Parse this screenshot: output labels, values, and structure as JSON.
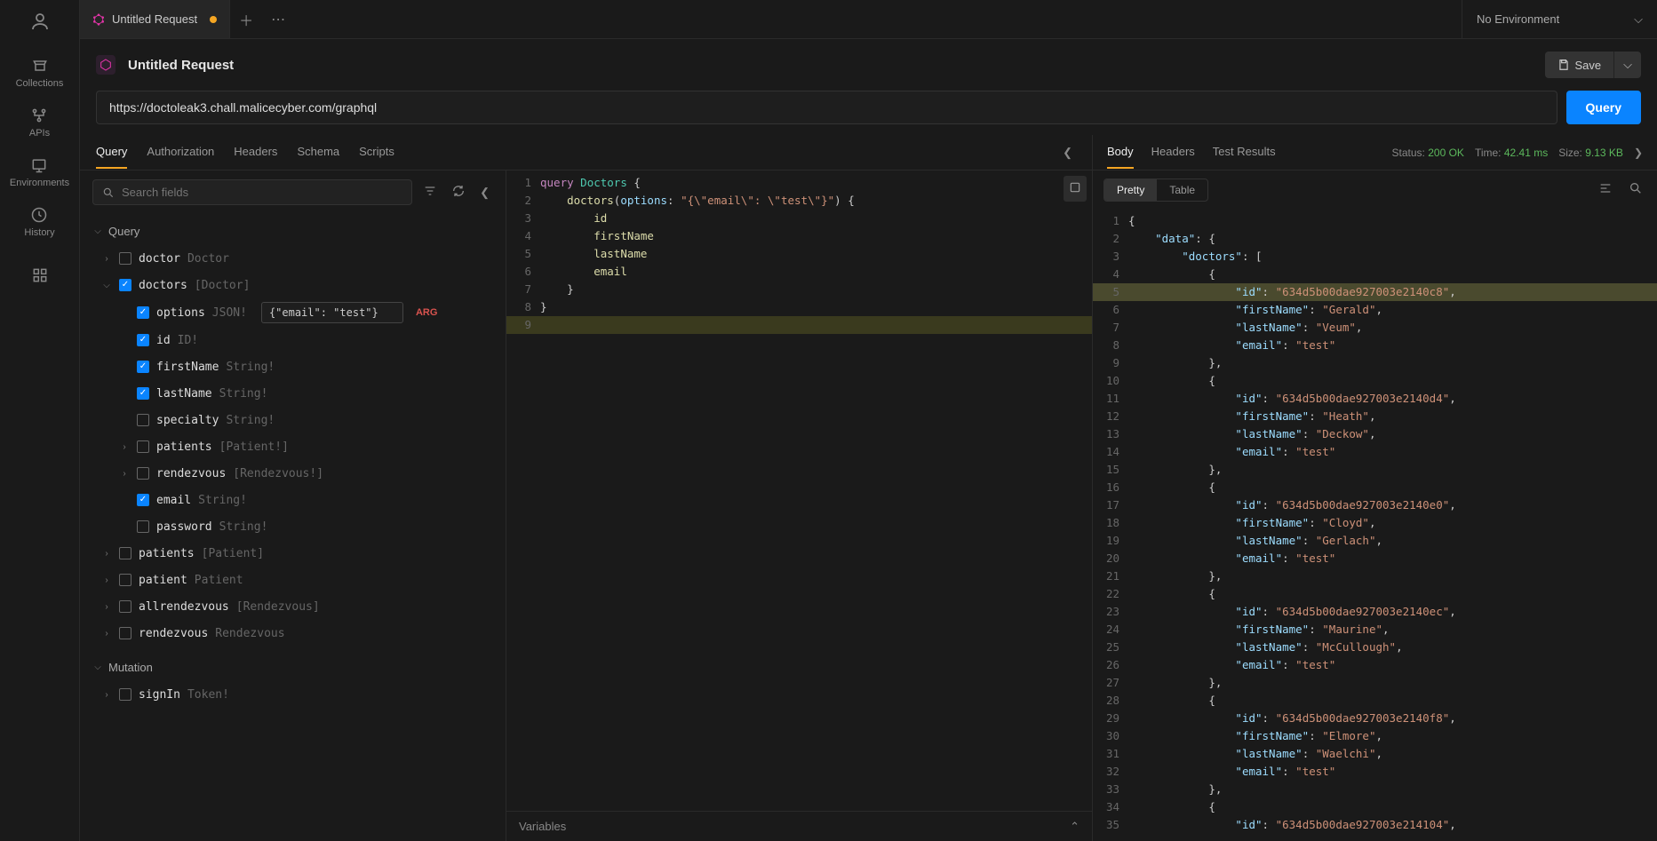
{
  "rail": {
    "items": [
      {
        "label": "Collections"
      },
      {
        "label": "APIs"
      },
      {
        "label": "Environments"
      },
      {
        "label": "History"
      }
    ]
  },
  "tab": {
    "title": "Untitled Request"
  },
  "env": {
    "label": "No Environment"
  },
  "request": {
    "title": "Untitled Request",
    "url": "https://doctoleak3.chall.malicecyber.com/graphql",
    "save_label": "Save",
    "query_label": "Query"
  },
  "req_tabs": [
    "Query",
    "Authorization",
    "Headers",
    "Schema",
    "Scripts"
  ],
  "req_active_tab": "Query",
  "schema_search_placeholder": "Search fields",
  "schema": {
    "query_label": "Query",
    "mutation_label": "Mutation",
    "fields": [
      {
        "name": "doctor",
        "type": "Doctor",
        "checked": false,
        "expandable": true,
        "depth": 1
      },
      {
        "name": "doctors",
        "type": "[Doctor]",
        "checked": true,
        "expandable": true,
        "expanded": true,
        "depth": 1
      },
      {
        "name": "options",
        "type": "JSON!",
        "checked": true,
        "depth": 2,
        "arg": true,
        "value": "{\"email\": \"test\"}"
      },
      {
        "name": "id",
        "type": "ID!",
        "checked": true,
        "depth": 2
      },
      {
        "name": "firstName",
        "type": "String!",
        "checked": true,
        "depth": 2
      },
      {
        "name": "lastName",
        "type": "String!",
        "checked": true,
        "depth": 2
      },
      {
        "name": "specialty",
        "type": "String!",
        "checked": false,
        "depth": 2
      },
      {
        "name": "patients",
        "type": "[Patient!]",
        "checked": false,
        "expandable": true,
        "depth": 2
      },
      {
        "name": "rendezvous",
        "type": "[Rendezvous!]",
        "checked": false,
        "expandable": true,
        "depth": 2
      },
      {
        "name": "email",
        "type": "String!",
        "checked": true,
        "depth": 2
      },
      {
        "name": "password",
        "type": "String!",
        "checked": false,
        "depth": 2
      },
      {
        "name": "patients",
        "type": "[Patient]",
        "checked": false,
        "expandable": true,
        "depth": 1
      },
      {
        "name": "patient",
        "type": "Patient",
        "checked": false,
        "expandable": true,
        "depth": 1
      },
      {
        "name": "allrendezvous",
        "type": "[Rendezvous]",
        "checked": false,
        "expandable": true,
        "depth": 1
      },
      {
        "name": "rendezvous",
        "type": "Rendezvous",
        "checked": false,
        "expandable": true,
        "depth": 1
      }
    ],
    "mutations": [
      {
        "name": "signIn",
        "type": "Token!",
        "checked": false,
        "expandable": true,
        "depth": 1
      }
    ]
  },
  "editor": {
    "lines": [
      {
        "n": 1,
        "html": "<span class='kw-purple'>query</span> <span class='kw-teal'>Doctors</span> <span class='brace'>{</span>"
      },
      {
        "n": 2,
        "html": "    <span class='kw-yellow'>doctors</span>(<span class='kw-blue'>options</span>: <span class='kw-str'>\"{\\\"email\\\": \\\"test\\\"}\"</span>) <span class='brace'>{</span>"
      },
      {
        "n": 3,
        "html": "        <span class='kw-yellow'>id</span>"
      },
      {
        "n": 4,
        "html": "        <span class='kw-yellow'>firstName</span>"
      },
      {
        "n": 5,
        "html": "        <span class='kw-yellow'>lastName</span>"
      },
      {
        "n": 6,
        "html": "        <span class='kw-yellow'>email</span>"
      },
      {
        "n": 7,
        "html": "    <span class='brace'>}</span>"
      },
      {
        "n": 8,
        "html": "<span class='brace'>}</span>"
      },
      {
        "n": 9,
        "html": ""
      }
    ],
    "variables_label": "Variables"
  },
  "response": {
    "tabs": [
      "Body",
      "Headers",
      "Test Results"
    ],
    "active_tab": "Body",
    "status_label": "Status:",
    "status_value": "200 OK",
    "time_label": "Time:",
    "time_value": "42.41 ms",
    "size_label": "Size:",
    "size_value": "9.13 KB",
    "view_modes": [
      "Pretty",
      "Table"
    ],
    "active_mode": "Pretty",
    "lines": [
      {
        "n": 1,
        "t": "<span class='brace'>{</span>"
      },
      {
        "n": 2,
        "t": "    <span class='kw-key'>\"data\"</span>: <span class='brace'>{</span>"
      },
      {
        "n": 3,
        "t": "        <span class='kw-key'>\"doctors\"</span>: <span class='brace'>[</span>"
      },
      {
        "n": 4,
        "t": "            <span class='brace'>{</span>"
      },
      {
        "n": 5,
        "hl": true,
        "t": "                <span class='kw-key'>\"id\"</span>: <span class='kw-str'>\"634d5b00dae927003e2140c8\"</span>,"
      },
      {
        "n": 6,
        "t": "                <span class='kw-key'>\"firstName\"</span>: <span class='kw-str'>\"Gerald\"</span>,"
      },
      {
        "n": 7,
        "t": "                <span class='kw-key'>\"lastName\"</span>: <span class='kw-str'>\"Veum\"</span>,"
      },
      {
        "n": 8,
        "t": "                <span class='kw-key'>\"email\"</span>: <span class='kw-str'>\"test\"</span>"
      },
      {
        "n": 9,
        "t": "            <span class='brace'>}</span>,"
      },
      {
        "n": 10,
        "t": "            <span class='brace'>{</span>"
      },
      {
        "n": 11,
        "t": "                <span class='kw-key'>\"id\"</span>: <span class='kw-str'>\"634d5b00dae927003e2140d4\"</span>,"
      },
      {
        "n": 12,
        "t": "                <span class='kw-key'>\"firstName\"</span>: <span class='kw-str'>\"Heath\"</span>,"
      },
      {
        "n": 13,
        "t": "                <span class='kw-key'>\"lastName\"</span>: <span class='kw-str'>\"Deckow\"</span>,"
      },
      {
        "n": 14,
        "t": "                <span class='kw-key'>\"email\"</span>: <span class='kw-str'>\"test\"</span>"
      },
      {
        "n": 15,
        "t": "            <span class='brace'>}</span>,"
      },
      {
        "n": 16,
        "t": "            <span class='brace'>{</span>"
      },
      {
        "n": 17,
        "t": "                <span class='kw-key'>\"id\"</span>: <span class='kw-str'>\"634d5b00dae927003e2140e0\"</span>,"
      },
      {
        "n": 18,
        "t": "                <span class='kw-key'>\"firstName\"</span>: <span class='kw-str'>\"Cloyd\"</span>,"
      },
      {
        "n": 19,
        "t": "                <span class='kw-key'>\"lastName\"</span>: <span class='kw-str'>\"Gerlach\"</span>,"
      },
      {
        "n": 20,
        "t": "                <span class='kw-key'>\"email\"</span>: <span class='kw-str'>\"test\"</span>"
      },
      {
        "n": 21,
        "t": "            <span class='brace'>}</span>,"
      },
      {
        "n": 22,
        "t": "            <span class='brace'>{</span>"
      },
      {
        "n": 23,
        "t": "                <span class='kw-key'>\"id\"</span>: <span class='kw-str'>\"634d5b00dae927003e2140ec\"</span>,"
      },
      {
        "n": 24,
        "t": "                <span class='kw-key'>\"firstName\"</span>: <span class='kw-str'>\"Maurine\"</span>,"
      },
      {
        "n": 25,
        "t": "                <span class='kw-key'>\"lastName\"</span>: <span class='kw-str'>\"McCullough\"</span>,"
      },
      {
        "n": 26,
        "t": "                <span class='kw-key'>\"email\"</span>: <span class='kw-str'>\"test\"</span>"
      },
      {
        "n": 27,
        "t": "            <span class='brace'>}</span>,"
      },
      {
        "n": 28,
        "t": "            <span class='brace'>{</span>"
      },
      {
        "n": 29,
        "t": "                <span class='kw-key'>\"id\"</span>: <span class='kw-str'>\"634d5b00dae927003e2140f8\"</span>,"
      },
      {
        "n": 30,
        "t": "                <span class='kw-key'>\"firstName\"</span>: <span class='kw-str'>\"Elmore\"</span>,"
      },
      {
        "n": 31,
        "t": "                <span class='kw-key'>\"lastName\"</span>: <span class='kw-str'>\"Waelchi\"</span>,"
      },
      {
        "n": 32,
        "t": "                <span class='kw-key'>\"email\"</span>: <span class='kw-str'>\"test\"</span>"
      },
      {
        "n": 33,
        "t": "            <span class='brace'>}</span>,"
      },
      {
        "n": 34,
        "t": "            <span class='brace'>{</span>"
      },
      {
        "n": 35,
        "t": "                <span class='kw-key'>\"id\"</span>: <span class='kw-str'>\"634d5b00dae927003e214104\"</span>,"
      }
    ]
  },
  "arg_badge": "ARG"
}
